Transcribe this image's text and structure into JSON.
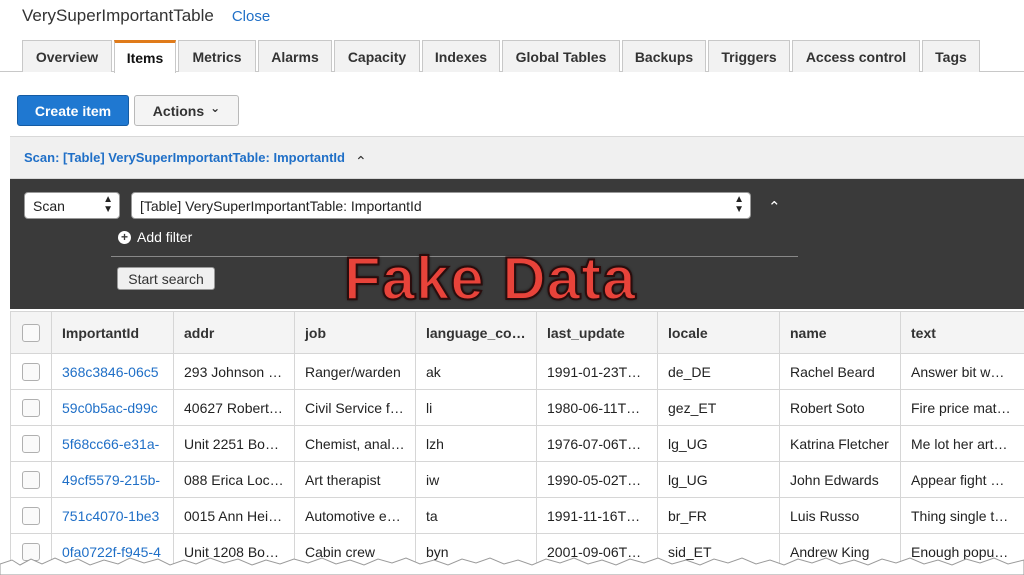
{
  "header": {
    "title": "VerySuperImportantTable",
    "close_label": "Close"
  },
  "tabs": [
    {
      "label": "Overview",
      "active": false
    },
    {
      "label": "Items",
      "active": true
    },
    {
      "label": "Metrics",
      "active": false
    },
    {
      "label": "Alarms",
      "active": false
    },
    {
      "label": "Capacity",
      "active": false
    },
    {
      "label": "Indexes",
      "active": false
    },
    {
      "label": "Global Tables",
      "active": false
    },
    {
      "label": "Backups",
      "active": false
    },
    {
      "label": "Triggers",
      "active": false
    },
    {
      "label": "Access control",
      "active": false
    },
    {
      "label": "Tags",
      "active": false
    }
  ],
  "toolbar": {
    "create_label": "Create item",
    "actions_label": "Actions",
    "actions_chevron": "⌄"
  },
  "scan": {
    "summary": "Scan: [Table] VerySuperImportantTable: ImportantId",
    "collapse_glyph": "⌃",
    "mode_value": "Scan",
    "target_value": "[Table] VerySuperImportantTable: ImportantId",
    "add_filter_label": "Add filter",
    "start_search_label": "Start search"
  },
  "overlay_text": "Fake Data",
  "colors": {
    "accent": "#1f78d1",
    "active_tab_top": "#e07b1a",
    "panel_bg": "#3a3a3a",
    "overlay": "#e8433a"
  },
  "table": {
    "columns": [
      "ImportantId",
      "addr",
      "job",
      "language_code",
      "last_update",
      "locale",
      "name",
      "text"
    ],
    "rows": [
      [
        "368c3846-06c5",
        "293 Johnson …",
        "Ranger/warden",
        "ak",
        "1991-01-23T…",
        "de_DE",
        "Rachel Beard",
        "Answer bit w…"
      ],
      [
        "59c0b5ac-d99c",
        "40627 Robert…",
        "Civil Service f…",
        "li",
        "1980-06-11T…",
        "gez_ET",
        "Robert Soto",
        "Fire price mat…"
      ],
      [
        "5f68cc66-e31a-",
        "Unit 2251 Bo…",
        "Chemist, anal…",
        "lzh",
        "1976-07-06T…",
        "lg_UG",
        "Katrina Fletcher",
        "Me lot her art…"
      ],
      [
        "49cf5579-215b-",
        "088 Erica Loc…",
        "Art therapist",
        "iw",
        "1990-05-02T…",
        "lg_UG",
        "John Edwards",
        "Appear fight …"
      ],
      [
        "751c4070-1be3",
        "0015 Ann Hei…",
        "Automotive e…",
        "ta",
        "1991-11-16T…",
        "br_FR",
        "Luis Russo",
        "Thing single t…"
      ],
      [
        "0fa0722f-f945-4",
        "Unit 1208 Bo…",
        "Cabin crew",
        "byn",
        "2001-09-06T…",
        "sid_ET",
        "Andrew King",
        "Enough popu…"
      ]
    ]
  }
}
